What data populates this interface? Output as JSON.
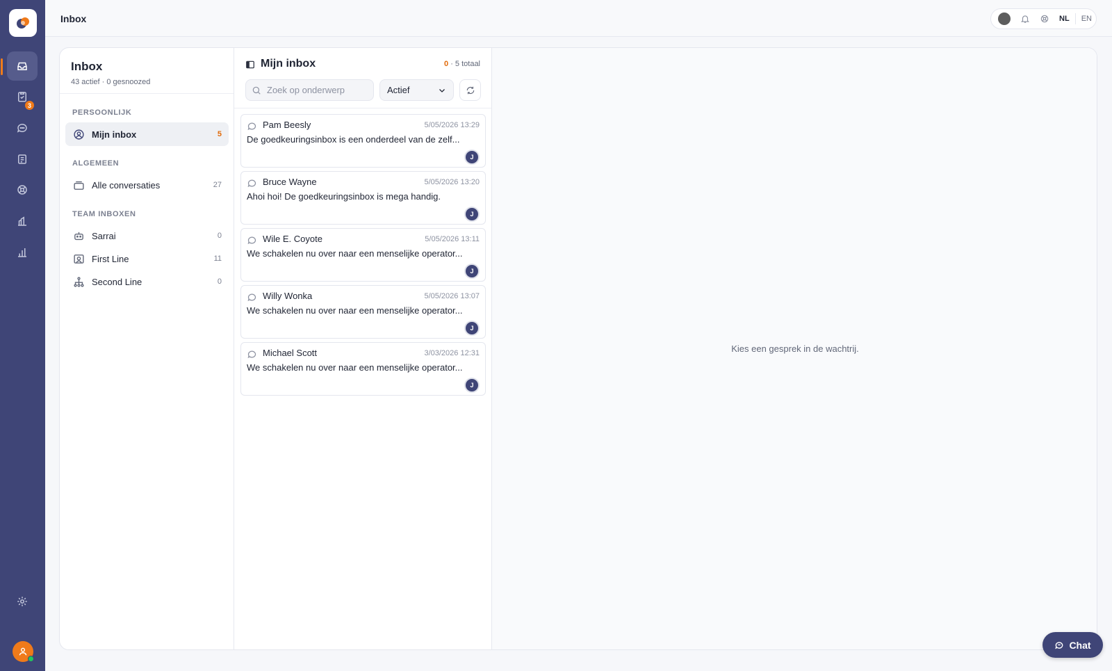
{
  "topbar": {
    "title": "Inbox",
    "lang_active": "NL",
    "lang_other": "EN"
  },
  "rail": {
    "tasks_badge": "3"
  },
  "nav": {
    "title": "Inbox",
    "subtitle": "43 actief · 0 gesnoozed",
    "sections": {
      "personal": "PERSOONLIJK",
      "general": "ALGEMEEN",
      "team": "TEAM INBOXEN"
    },
    "items": [
      {
        "label": "Mijn inbox",
        "count": "5"
      },
      {
        "label": "Alle conversaties",
        "count": "27"
      },
      {
        "label": "Sarrai",
        "count": "0"
      },
      {
        "label": "First Line",
        "count": "11"
      },
      {
        "label": "Second Line",
        "count": "0"
      }
    ]
  },
  "list": {
    "title": "Mijn inbox",
    "count_highlight": "0",
    "count_rest": " · 5 totaal",
    "search_placeholder": "Zoek op onderwerp",
    "filter_value": "Actief",
    "conversations": [
      {
        "name": "Pam Beesly",
        "time": "5/05/2026 13:29",
        "message": "De goedkeuringsinbox is een onderdeel van de zelf...",
        "avatar": "J"
      },
      {
        "name": "Bruce Wayne",
        "time": "5/05/2026 13:20",
        "message": "Ahoi hoi! De goedkeuringsinbox is mega handig.",
        "avatar": "J"
      },
      {
        "name": "Wile E. Coyote",
        "time": "5/05/2026 13:11",
        "message": "We schakelen nu over naar een menselijke operator...",
        "avatar": "J"
      },
      {
        "name": "Willy Wonka",
        "time": "5/05/2026 13:07",
        "message": "We schakelen nu over naar een menselijke operator...",
        "avatar": "J"
      },
      {
        "name": "Michael Scott",
        "time": "3/03/2026 12:31",
        "message": "We schakelen nu over naar een menselijke operator...",
        "avatar": "J"
      }
    ]
  },
  "detail": {
    "empty_text": "Kies een gesprek in de wachtrij."
  },
  "chat_button": {
    "label": "Chat"
  },
  "colors": {
    "rail": "#3f4577",
    "accent": "#ef7a1a"
  }
}
